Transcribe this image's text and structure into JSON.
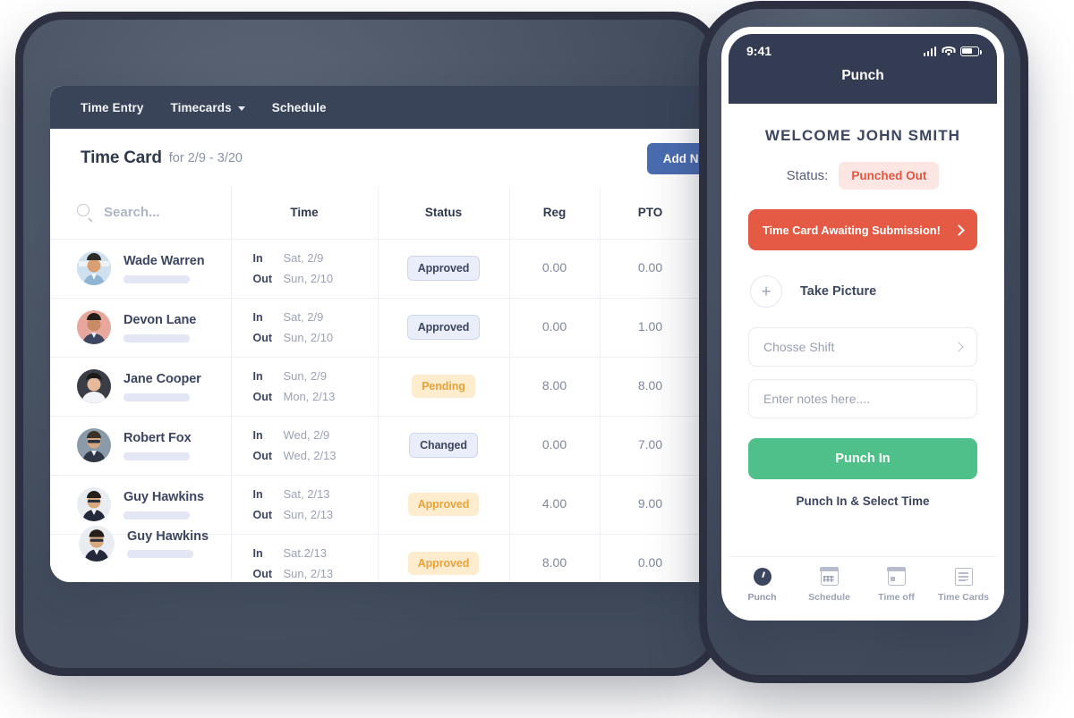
{
  "desktop": {
    "nav": [
      {
        "label": "Time Entry",
        "dropdown": false
      },
      {
        "label": "Timecards",
        "dropdown": true
      },
      {
        "label": "Schedule",
        "dropdown": false
      }
    ],
    "title": "Time Card",
    "subtitle": "for 2/9 - 3/20",
    "add_button": "Add Ne",
    "search_placeholder": "Search...",
    "columns": [
      "Time",
      "Status",
      "Reg",
      "PTO"
    ],
    "rows": [
      {
        "employee": "Wade Warren",
        "in_label": "In",
        "in_date": "Sat, 2/9",
        "out_label": "Out",
        "out_date": "Sun, 2/10",
        "status": "Approved",
        "status_tone": "blue",
        "reg": "0.00",
        "pto": "0.00",
        "avatar_bg": "#cfe0ef",
        "avatar_skin": "#d9a074",
        "avatar_shirt": "#8fb4d4"
      },
      {
        "employee": "Devon Lane",
        "in_label": "In",
        "in_date": "Sat, 2/9",
        "out_label": "Out",
        "out_date": "Sun, 2/10",
        "status": "Approved",
        "status_tone": "blue",
        "reg": "0.00",
        "pto": "1.00",
        "avatar_bg": "#e8a79c",
        "avatar_skin": "#c98a66",
        "avatar_shirt": "#3c4660"
      },
      {
        "employee": "Jane Cooper",
        "in_label": "In",
        "in_date": "Sun, 2/9",
        "out_label": "Out",
        "out_date": "Mon, 2/13",
        "status": "Pending",
        "status_tone": "orange",
        "reg": "8.00",
        "pto": "8.00",
        "avatar_bg": "#3a3c46",
        "avatar_skin": "#e6b99a",
        "avatar_shirt": "#ffffff"
      },
      {
        "employee": "Robert Fox",
        "in_label": "In",
        "in_date": "Wed, 2/9",
        "out_label": "Out",
        "out_date": "Wed, 2/13",
        "status": "Changed",
        "status_tone": "blue",
        "reg": "0.00",
        "pto": "7.00",
        "avatar_bg": "#8a9aa8",
        "avatar_skin": "#d6a882",
        "avatar_shirt": "#2f3645"
      },
      {
        "employee": "Guy Hawkins",
        "in_label": "In",
        "in_date": "Sat, 2/13",
        "out_label": "Out",
        "out_date": "Sun, 2/13",
        "status": "Approved",
        "status_tone": "orange",
        "reg": "4.00",
        "pto": "9.00",
        "avatar_bg": "#e9edf2",
        "avatar_skin": "#d8a87e",
        "avatar_shirt": "#23283a"
      },
      {
        "employee": "",
        "in_label": "In",
        "in_date": "Sat.2/13",
        "out_label": "Out",
        "out_date": "Sun, 2/13",
        "status": "Approved",
        "status_tone": "orange",
        "reg": "8.00",
        "pto": "0.00",
        "avatar_bg": "",
        "avatar_skin": "",
        "avatar_shirt": ""
      }
    ]
  },
  "phone": {
    "status_bar": {
      "time": "9:41"
    },
    "header_title": "Punch",
    "welcome": "WELCOME JOHN SMITH",
    "status_label": "Status:",
    "status_value": "Punched Out",
    "alert_text": "Time Card Awaiting Submission!",
    "take_picture": "Take Picture",
    "shift_field": "Chosse Shift",
    "notes_placeholder": "Enter notes here....",
    "punch_button": "Punch In",
    "secondary_link": "Punch In & Select Time",
    "tabs": [
      {
        "label": "Punch",
        "icon": "clock-icon",
        "active": true
      },
      {
        "label": "Schedule",
        "icon": "calendar-icon",
        "active": false
      },
      {
        "label": "Time off",
        "icon": "calendar-day-icon",
        "active": false
      },
      {
        "label": "Time Cards",
        "icon": "document-icon",
        "active": false
      }
    ]
  },
  "colors": {
    "nav_dark": "#3a4459",
    "accent_blue": "#4a6cb0",
    "alert_red": "#e45a44",
    "punch_green": "#4fc08a",
    "badge_orange": "#e8a33c",
    "frame_slate": "#4a5568"
  }
}
